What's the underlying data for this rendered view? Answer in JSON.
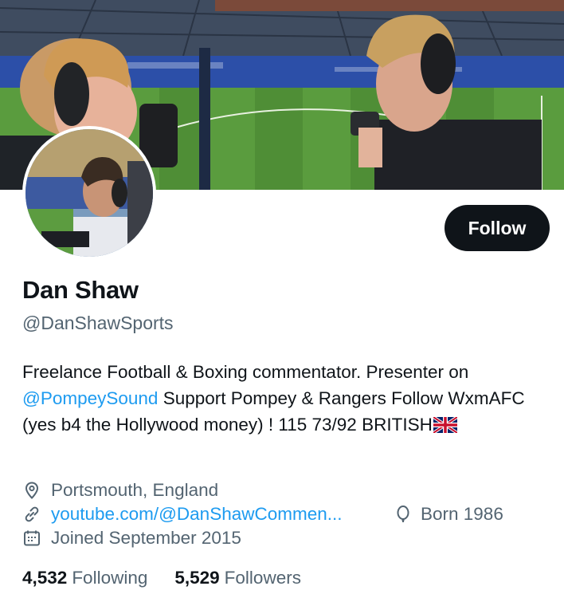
{
  "profile": {
    "name": "Dan Shaw",
    "handle": "@DanShawSports",
    "follow_label": "Follow",
    "bio": {
      "part1": "Freelance Football & Boxing commentator. Presenter on ",
      "mention": "@PompeySound",
      "part2": " Support Pompey & Rangers Follow WxmAFC (yes b4 the Hollywood money) ! 115 73/92 BRITISH"
    },
    "location": "Portsmouth, England",
    "website": "youtube.com/@DanShawCommen...",
    "born": "Born 1986",
    "joined": "Joined September 2015",
    "following_count": "4,532",
    "following_label": "Following",
    "followers_count": "5,529",
    "followers_label": "Followers"
  },
  "icons": {
    "location": "map-pin-icon",
    "website": "link-icon",
    "born": "balloon-icon",
    "joined": "calendar-icon",
    "flag": "uk-flag-icon"
  },
  "colors": {
    "accent": "#1d9bf0",
    "text": "#0f1419",
    "secondary": "#536471",
    "button_bg": "#0f1419"
  }
}
